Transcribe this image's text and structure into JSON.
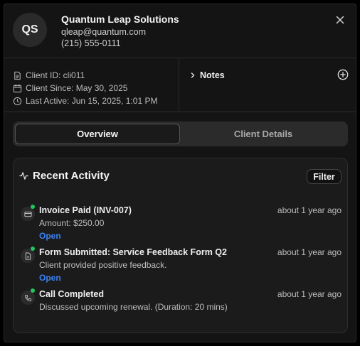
{
  "client": {
    "initials": "QS",
    "name": "Quantum Leap Solutions",
    "email": "qleap@quantum.com",
    "phone": "(215) 555-0111"
  },
  "meta": {
    "client_id": "Client ID: cli011",
    "client_since": "Client Since: May 30, 2025",
    "last_active": "Last Active: Jun 15, 2025, 1:01 PM"
  },
  "notes": {
    "label": "Notes"
  },
  "tabs": [
    {
      "label": "Overview",
      "active": true
    },
    {
      "label": "Client Details",
      "active": false
    }
  ],
  "activity": {
    "title": "Recent Activity",
    "filter_label": "Filter",
    "items": [
      {
        "icon": "credit-card-icon",
        "title": "Invoice Paid (INV-007)",
        "time": "about 1 year ago",
        "desc": "Amount: $250.00",
        "link": "Open"
      },
      {
        "icon": "file-icon",
        "title": "Form Submitted: Service Feedback Form Q2",
        "time": "about 1 year ago",
        "desc": "Client provided positive feedback.",
        "link": "Open"
      },
      {
        "icon": "phone-icon",
        "title": "Call Completed",
        "time": "about 1 year ago",
        "desc": "Discussed upcoming renewal. (Duration: 20 mins)"
      }
    ]
  },
  "colors": {
    "status_dot": "#22c55e",
    "link": "#3b82f6"
  }
}
